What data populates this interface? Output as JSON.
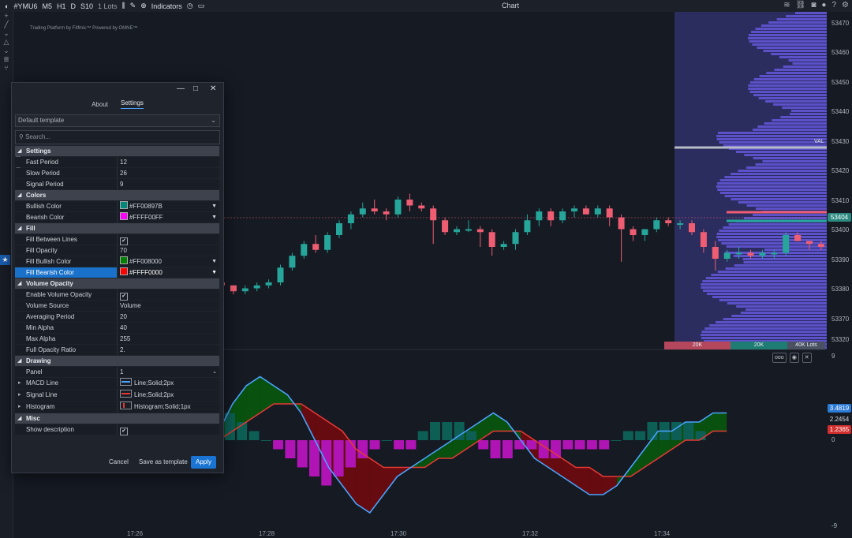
{
  "toolbar": {
    "symbol": "#YMU6",
    "timeframes": [
      "M5",
      "H1",
      "D",
      "S10"
    ],
    "lots": "1 Lots",
    "indicators_label": "Indicators",
    "title": "Chart"
  },
  "watermark": "Trading Platform by Fitfmic™ Powered by OMNE™",
  "price_axis": {
    "labels": [
      "53470",
      "53460",
      "53450",
      "53440",
      "53430",
      "53420",
      "53410",
      "53400",
      "53390",
      "53380",
      "53370",
      "53320"
    ],
    "tag_val": "VAL",
    "tag_last": "53404",
    "macd_labels": [
      "9",
      "0",
      "-9"
    ],
    "macd_tags": [
      "3.4819",
      "2.2454",
      "1.2365"
    ]
  },
  "time_axis": [
    "17:26",
    "17:28",
    "17:30",
    "17:32",
    "17:34"
  ],
  "volume_profile": {
    "left": "20K",
    "mid": "20K",
    "right": "40K Lots"
  },
  "panel_controls": [
    "ooo",
    "◉",
    "✕"
  ],
  "dialog": {
    "tabs": [
      "About",
      "Settings"
    ],
    "template": "Default template",
    "search_placeholder": "Search...",
    "settings": {
      "title": "Settings",
      "fast": "Fast Period",
      "fast_v": "12",
      "slow": "Slow Period",
      "slow_v": "26",
      "signal": "Signal Period",
      "signal_v": "9"
    },
    "colors": {
      "title": "Colors",
      "bull": "Bullish Color",
      "bull_v": "#FF00897B",
      "bear": "Bearish Color",
      "bear_v": "#FFFF00FF"
    },
    "fill": {
      "title": "Fill",
      "between": "Fill Between Lines",
      "opacity": "Fill Opacity",
      "opacity_v": "70",
      "bull": "Fill Bullish Color",
      "bull_v": "#FF008000",
      "bear": "Fill Bearish Color",
      "bear_v": "#FFFF0000"
    },
    "volume": {
      "title": "Volume Opacity",
      "enable": "Enable Volume Opacity",
      "source": "Volume Source",
      "source_v": "Volume",
      "avg": "Averaging Period",
      "avg_v": "20",
      "min": "Min Alpha",
      "min_v": "40",
      "max": "Max Alpha",
      "max_v": "255",
      "full": "Full Opacity Ratio",
      "full_v": "2."
    },
    "drawing": {
      "title": "Drawing",
      "panel": "Panel",
      "panel_v": "1",
      "macd": "MACD Line",
      "macd_v": "Line;Solid;2px",
      "signal": "Signal Line",
      "signal_v": "Line;Solid;2px",
      "hist": "Histogram",
      "hist_v": "Histogram;Solid;1px"
    },
    "misc": {
      "title": "Misc",
      "show": "Show description"
    },
    "buttons": {
      "cancel": "Cancel",
      "save": "Save as template",
      "apply": "Apply"
    }
  },
  "colors": {
    "bull": "#26a69a",
    "bear": "#ef5d73",
    "macd": "#4aa3ff",
    "signal": "#e53935",
    "accent": "#1a74d4"
  },
  "chart_data": {
    "type": "candlestick",
    "timeframe": "S10",
    "candles": [
      [
        53382,
        53383,
        53380,
        53381
      ],
      [
        53381,
        53381,
        53378,
        53379
      ],
      [
        53379,
        53381,
        53378,
        53380
      ],
      [
        53380,
        53382,
        53379,
        53381
      ],
      [
        53381,
        53383,
        53380,
        53382
      ],
      [
        53382,
        53388,
        53381,
        53387
      ],
      [
        53387,
        53392,
        53386,
        53391
      ],
      [
        53391,
        53396,
        53390,
        53395
      ],
      [
        53395,
        53398,
        53392,
        53393
      ],
      [
        53393,
        53399,
        53392,
        53398
      ],
      [
        53398,
        53403,
        53397,
        53402
      ],
      [
        53402,
        53406,
        53400,
        53405
      ],
      [
        53405,
        53409,
        53404,
        53407
      ],
      [
        53407,
        53410,
        53405,
        53406
      ],
      [
        53406,
        53407,
        53403,
        53405
      ],
      [
        53405,
        53411,
        53404,
        53410
      ],
      [
        53410,
        53412,
        53406,
        53408
      ],
      [
        53408,
        53409,
        53406,
        53407
      ],
      [
        53407,
        53408,
        53395,
        53403
      ],
      [
        53403,
        53404,
        53398,
        53399
      ],
      [
        53399,
        53401,
        53398,
        53400
      ],
      [
        53400,
        53403,
        53399,
        53400
      ],
      [
        53400,
        53401,
        53394,
        53399
      ],
      [
        53399,
        53400,
        53391,
        53394
      ],
      [
        53394,
        53396,
        53393,
        53395
      ],
      [
        53395,
        53400,
        53393,
        53399
      ],
      [
        53399,
        53405,
        53398,
        53403
      ],
      [
        53403,
        53407,
        53401,
        53406
      ],
      [
        53406,
        53407,
        53401,
        53403
      ],
      [
        53403,
        53407,
        53402,
        53406
      ],
      [
        53406,
        53408,
        53404,
        53407
      ],
      [
        53407,
        53408,
        53405,
        53405
      ],
      [
        53405,
        53408,
        53404,
        53407
      ],
      [
        53407,
        53408,
        53401,
        53404
      ],
      [
        53404,
        53405,
        53389,
        53400
      ],
      [
        53400,
        53401,
        53396,
        53398
      ],
      [
        53398,
        53400,
        53396,
        53400
      ],
      [
        53400,
        53404,
        53399,
        53403
      ],
      [
        53403,
        53404,
        53401,
        53402
      ],
      [
        53402,
        53403,
        53400,
        53402
      ],
      [
        53402,
        53403,
        53398,
        53399
      ],
      [
        53399,
        53400,
        53392,
        53394
      ],
      [
        53394,
        53396,
        53386,
        53390
      ],
      [
        53390,
        53393,
        53389,
        53392
      ],
      [
        53392,
        53394,
        53390,
        53392
      ],
      [
        53392,
        53393,
        53390,
        53391
      ],
      [
        53391,
        53393,
        53390,
        53392
      ],
      [
        53392,
        53393,
        53390,
        53392
      ],
      [
        53392,
        53399,
        53391,
        53398
      ],
      [
        53398,
        53399,
        53396,
        53396
      ],
      [
        53396,
        53396,
        53393,
        53395
      ],
      [
        53395,
        53396,
        53393,
        53394
      ],
      [
        53394,
        53395,
        53389,
        53393
      ],
      [
        53393,
        53399,
        53392,
        53397
      ],
      [
        53397,
        53407,
        53396,
        53405
      ],
      [
        53405,
        53410,
        53397,
        53401
      ],
      [
        53401,
        53405,
        53400,
        53404
      ]
    ],
    "macd_range": [
      -9,
      9
    ],
    "histogram": [
      -2,
      -2,
      -3,
      -3,
      -3,
      -3,
      -1,
      -1,
      1,
      1,
      2,
      2,
      3,
      3,
      2,
      1,
      0,
      -1,
      -2,
      -3,
      -4,
      -5,
      -4,
      -3,
      -2,
      -1,
      0,
      -1,
      -1,
      1,
      2,
      2,
      2,
      1,
      -1,
      -2,
      -2,
      -1,
      -1,
      -2,
      -2,
      -1,
      -1,
      -1,
      -1,
      0,
      1,
      1,
      2,
      2,
      2,
      2,
      1
    ],
    "macd_line": [
      2,
      4,
      6,
      5,
      1,
      -1,
      -2,
      -3,
      -3,
      -2,
      -1,
      1,
      4,
      6,
      7,
      6,
      5,
      3,
      0,
      -3,
      -5,
      -7,
      -8,
      -6,
      -4,
      -3,
      -2,
      -1,
      0,
      1,
      2,
      3,
      2,
      0,
      -2,
      -3,
      -4,
      -5,
      -6,
      -6,
      -5,
      -3,
      -1,
      1,
      1,
      2,
      2,
      3,
      3
    ],
    "signal_line": [
      1,
      2,
      3,
      3,
      2,
      1,
      0,
      -1,
      -1,
      -1,
      -1,
      0,
      1,
      2,
      3,
      4,
      4,
      4,
      3,
      2,
      1,
      -1,
      -2,
      -3,
      -3,
      -3,
      -3,
      -2,
      -2,
      -1,
      0,
      1,
      1,
      1,
      0,
      -1,
      -2,
      -3,
      -3,
      -4,
      -4,
      -4,
      -3,
      -2,
      -1,
      0,
      0,
      1,
      1
    ]
  }
}
